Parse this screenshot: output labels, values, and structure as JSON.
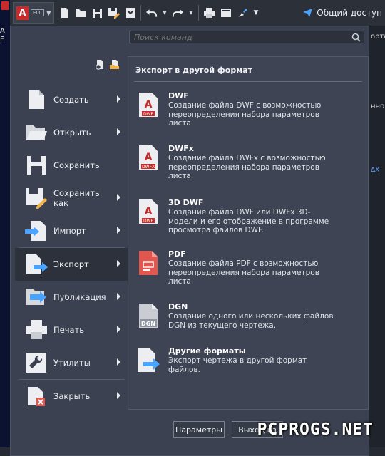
{
  "titlebar": {
    "app_logo_letter": "A",
    "app_badge": "ELC",
    "share_label": "Общий доступ",
    "icons": [
      "new-icon",
      "open-icon",
      "save-icon",
      "save-as-icon",
      "import-icon",
      "undo-icon",
      "redo-icon",
      "print-icon",
      "plot-icon",
      "match-properties-icon",
      "overflow-icon",
      "share-icon"
    ]
  },
  "background": {
    "left_fragments": [
      "A",
      "E"
    ],
    "right_fragments": [
      "орта",
      "нно",
      "ΔΧ"
    ]
  },
  "search": {
    "placeholder": "Поиск команд"
  },
  "menu": {
    "items": [
      {
        "label": "Создать",
        "has_arrow": true
      },
      {
        "label": "Открыть",
        "has_arrow": true
      },
      {
        "label": "Сохранить",
        "has_arrow": false
      },
      {
        "label": "Сохранить как",
        "has_arrow": true
      },
      {
        "label": "Импорт",
        "has_arrow": true
      },
      {
        "label": "Экспорт",
        "has_arrow": true,
        "active": true
      },
      {
        "label": "Публикация",
        "has_arrow": true
      },
      {
        "label": "Печать",
        "has_arrow": true
      },
      {
        "label": "Утилиты",
        "has_arrow": true
      },
      {
        "label": "Закрыть",
        "has_arrow": true
      }
    ]
  },
  "submenu": {
    "title": "Экспорт в другой формат",
    "entries": [
      {
        "name": "DWF",
        "desc": "Создание файла DWF с возможностью переопределения набора параметров листа.",
        "badge": "DWF"
      },
      {
        "name": "DWFx",
        "desc": "Создание файла DWFx с возможностью переопределения набора параметров листа.",
        "badge": "DWFX"
      },
      {
        "name": "3D DWF",
        "desc": "Создание файла DWF или DWFx 3D-модели и его отображение в программе просмотра файлов DWF.",
        "badge": "DWF"
      },
      {
        "name": "PDF",
        "desc": "Создание файла PDF с возможностью переопределения набора параметров листа.",
        "badge": ""
      },
      {
        "name": "DGN",
        "desc": "Создание одного или нескольких файлов DGN из текущего чертежа.",
        "badge": "DGN"
      },
      {
        "name": "Другие форматы",
        "desc": "Экспорт чертежа в другой формат файлов.",
        "badge": ""
      }
    ]
  },
  "buttons": {
    "options": "Параметры",
    "exit": "Выход из"
  },
  "watermark": "PCPROGS.NET",
  "colors": {
    "accent_red": "#c92a2a",
    "pdf_red": "#e0574f",
    "arrow_blue": "#4aa3ff"
  }
}
